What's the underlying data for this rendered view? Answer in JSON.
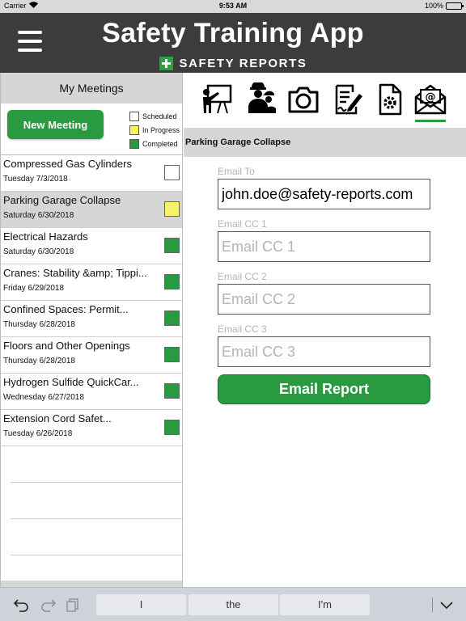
{
  "status_bar": {
    "carrier": "Carrier",
    "time": "9:53 AM",
    "battery": "100%"
  },
  "header": {
    "title": "Safety Training App",
    "brand": "SAFETY REPORTS"
  },
  "sidebar": {
    "title": "My Meetings",
    "new_meeting_label": "New Meeting",
    "legend": [
      {
        "label": "Scheduled",
        "color": "#ffffff"
      },
      {
        "label": "In Progress",
        "color": "#f7f266"
      },
      {
        "label": "Completed",
        "color": "#2a9a40"
      }
    ],
    "meetings": [
      {
        "name": "Compressed Gas Cylinders",
        "date": "Tuesday 7/3/2018",
        "status": "scheduled"
      },
      {
        "name": "Parking Garage Collapse",
        "date": "Saturday 6/30/2018",
        "status": "in-progress",
        "selected": true
      },
      {
        "name": "Electrical Hazards",
        "date": "Saturday 6/30/2018",
        "status": "completed"
      },
      {
        "name": "Cranes: Stability &amp; Tippi...",
        "date": "Friday 6/29/2018",
        "status": "completed"
      },
      {
        "name": "Confined Spaces: Permit...",
        "date": "Thursday 6/28/2018",
        "status": "completed"
      },
      {
        "name": "Floors and Other Openings",
        "date": "Thursday 6/28/2018",
        "status": "completed"
      },
      {
        "name": "Hydrogen Sulfide QuickCar...",
        "date": "Wednesday 6/27/2018",
        "status": "completed"
      },
      {
        "name": "Extension Cord Safet...",
        "date": "Tuesday 6/26/2018",
        "status": "completed"
      }
    ]
  },
  "toolbar": {
    "tools": [
      {
        "icon": "presentation-icon"
      },
      {
        "icon": "workers-icon"
      },
      {
        "icon": "camera-icon"
      },
      {
        "icon": "sign-document-icon"
      },
      {
        "icon": "document-settings-icon"
      },
      {
        "icon": "email-icon",
        "active": true
      }
    ]
  },
  "content": {
    "section_title": "Parking Garage Collapse",
    "email_to": {
      "label": "Email To",
      "value": "john.doe@safety-reports.com"
    },
    "email_cc1": {
      "label": "Email CC 1",
      "placeholder": "Email CC 1"
    },
    "email_cc2": {
      "label": "Email CC 2",
      "placeholder": "Email CC 2"
    },
    "email_cc3": {
      "label": "Email CC 3",
      "placeholder": "Email CC 3"
    },
    "email_button_label": "Email Report"
  },
  "keyboard": {
    "suggestions": [
      "I",
      "the",
      "I'm"
    ],
    "icons": [
      "undo-icon",
      "redo-icon",
      "paste-icon",
      "dismiss-keyboard-icon"
    ]
  },
  "colors": {
    "header_bg": "#3c3c3c",
    "accent_green": "#2a9a40",
    "in_progress_yellow": "#f7f266",
    "panel_gray": "#d6d6d6"
  }
}
